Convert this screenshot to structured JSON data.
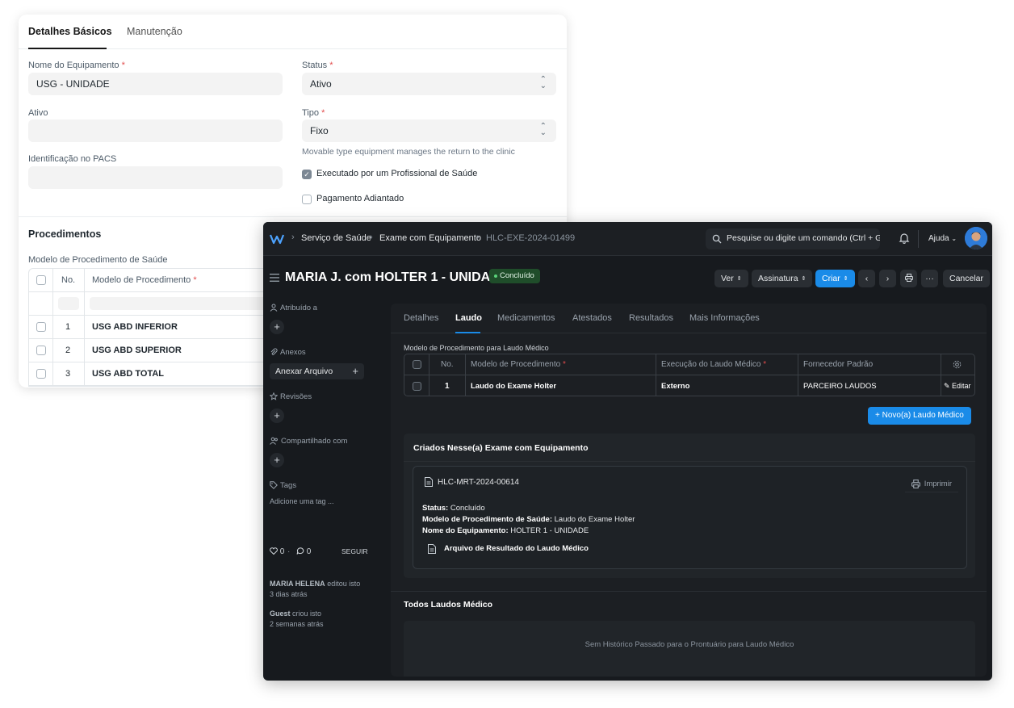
{
  "light": {
    "tabs": [
      "Detalhes Básicos",
      "Manutenção"
    ],
    "fields": {
      "nome_label": "Nome do Equipamento",
      "nome_value": "USG - UNIDADE",
      "ativo_label": "Ativo",
      "pacs_label": "Identificação no PACS",
      "status_label": "Status",
      "status_value": "Ativo",
      "tipo_label": "Tipo",
      "tipo_value": "Fixo",
      "tipo_help": "Movable type equipment manages the return to the clinic",
      "check1_label": "Executado por um Profissional de Saúde",
      "check2_label": "Pagamento Adiantado",
      "required_mark": "*"
    },
    "procedures": {
      "title": "Procedimentos",
      "table_label": "Modelo de Procedimento de Saúde",
      "headers": [
        "No.",
        "Modelo de Procedimento"
      ],
      "rows": [
        {
          "no": "1",
          "name": "USG ABD INFERIOR"
        },
        {
          "no": "2",
          "name": "USG ABD SUPERIOR"
        },
        {
          "no": "3",
          "name": "USG ABD TOTAL"
        }
      ]
    }
  },
  "dark": {
    "breadcrumbs": [
      "Serviço de Saúde",
      "Exame com Equipamento",
      "HLC-EXE-2024-01499"
    ],
    "search_placeholder": "Pesquise ou digite um comando (Ctrl + G)",
    "help_label": "Ajuda",
    "title": "MARIA J. com HOLTER 1 - UNIDADE",
    "status_badge": "Concluído",
    "buttons": {
      "ver": "Ver",
      "assinatura": "Assinatura",
      "criar": "Criar",
      "cancelar": "Cancelar",
      "more": "···"
    },
    "sidebar": {
      "atribuido": "Atribuído a",
      "anexos": "Anexos",
      "anexar": "Anexar Arquivo",
      "revisoes": "Revisões",
      "compartilhado": "Compartilhado com",
      "tags": "Tags",
      "add_tag": "Adicione uma tag ...",
      "likes": "0",
      "comments": "0",
      "follow": "SEGUIR",
      "activity": [
        {
          "who": "MARIA HELENA",
          "what": "editou isto",
          "when": "3 dias atrás"
        },
        {
          "who": "Guest",
          "what": "criou isto",
          "when": "2 semanas atrás"
        }
      ]
    },
    "tabs": [
      "Detalhes",
      "Laudo",
      "Medicamentos",
      "Atestados",
      "Resultados",
      "Mais Informações"
    ],
    "laudo": {
      "table_label": "Modelo de Procedimento para Laudo Médico",
      "headers": [
        "No.",
        "Modelo de Procedimento",
        "Execução do Laudo Médico",
        "Fornecedor Padrão"
      ],
      "row": {
        "no": "1",
        "modelo": "Laudo do Exame Holter",
        "execucao": "Externo",
        "fornecedor": "PARCEIRO LAUDOS",
        "edit": "Editar"
      },
      "new_button": "Novo(a) Laudo Médico",
      "created_title": "Criados Nesse(a) Exame com Equipamento",
      "card": {
        "id": "HLC-MRT-2024-00614",
        "print": "Imprimir",
        "status_label": "Status:",
        "status_value": "Concluído",
        "modelo_label": "Modelo de Procedimento de Saúde:",
        "modelo_value": "Laudo do Exame Holter",
        "equip_label": "Nome do Equipamento:",
        "equip_value": "HOLTER 1 - UNIDADE",
        "file": "Arquivo de Resultado do Laudo Médico"
      },
      "all_title": "Todos Laudos Médico",
      "empty": "Sem Histórico Passado para o Prontuário para Laudo Médico"
    }
  },
  "colors": {
    "accent": "#1a8be8",
    "success_bg": "#1f4d2a",
    "dark_bg": "#171a1e"
  }
}
